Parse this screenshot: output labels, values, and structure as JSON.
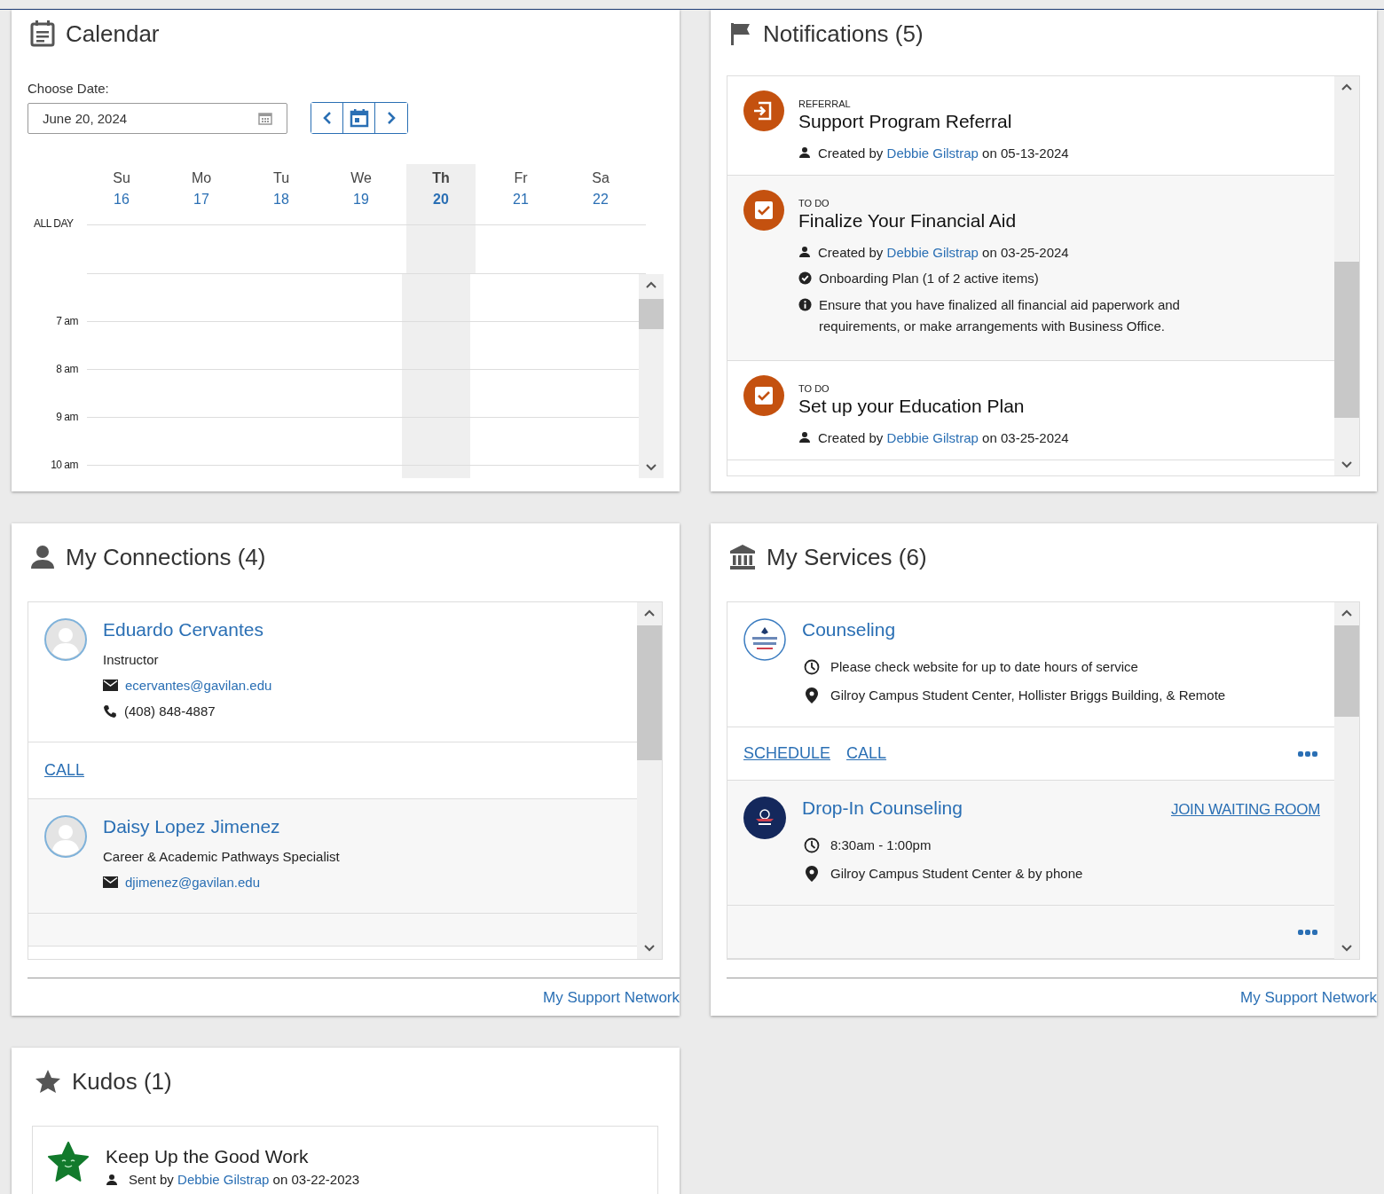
{
  "calendar": {
    "title": "Calendar",
    "date_label": "Choose Date:",
    "date_value": "June 20, 2024",
    "days": [
      {
        "name": "Su",
        "date": "16",
        "selected": false
      },
      {
        "name": "Mo",
        "date": "17",
        "selected": false
      },
      {
        "name": "Tu",
        "date": "18",
        "selected": false
      },
      {
        "name": "We",
        "date": "19",
        "selected": false
      },
      {
        "name": "Th",
        "date": "20",
        "selected": true
      },
      {
        "name": "Fr",
        "date": "21",
        "selected": false
      },
      {
        "name": "Sa",
        "date": "22",
        "selected": false
      }
    ],
    "all_day_label": "ALL DAY",
    "hours": [
      "7 am",
      "8 am",
      "9 am",
      "10 am"
    ]
  },
  "notifications": {
    "title": "Notifications (5)",
    "items": [
      {
        "kind": "referral",
        "category": "REFERRAL",
        "title": "Support Program Referral",
        "details": [
          {
            "kind": "creator",
            "prefix": "Created by",
            "person": "Debbie Gilstrap",
            "suffix": "on 05-13-2024"
          }
        ]
      },
      {
        "kind": "todo",
        "category": "TO DO",
        "title": "Finalize Your Financial Aid",
        "details": [
          {
            "kind": "creator",
            "prefix": "Created by",
            "person": "Debbie Gilstrap",
            "suffix": "on 03-25-2024"
          },
          {
            "kind": "plan",
            "text": "Onboarding Plan (1 of 2 active items)"
          },
          {
            "kind": "info",
            "text": "Ensure that you have finalized all financial aid paperwork and requirements, or make arrangements with Business Office."
          }
        ]
      },
      {
        "kind": "todo",
        "category": "TO DO",
        "title": "Set up your Education Plan",
        "details": [
          {
            "kind": "creator",
            "prefix": "Created by",
            "person": "Debbie Gilstrap",
            "suffix": "on 03-25-2024"
          }
        ]
      }
    ]
  },
  "connections": {
    "title": "My Connections (4)",
    "items": [
      {
        "name": "Eduardo Cervantes",
        "role": "Instructor",
        "email": "ecervantes@gavilan.edu",
        "phone": "(408) 848-4887",
        "actions": [
          "CALL"
        ]
      },
      {
        "name": "Daisy Lopez Jimenez",
        "role": "Career & Academic Pathways Specialist",
        "email": "djimenez@gavilan.edu"
      }
    ],
    "footer_link": "My Support Network"
  },
  "services": {
    "title": "My Services (6)",
    "items": [
      {
        "kind": "crest",
        "name": "Counseling",
        "hours": "Please check website for up to date hours of service",
        "location": "Gilroy Campus Student Center, Hollister Briggs Building, & Remote",
        "actions": [
          "SCHEDULE",
          "CALL"
        ]
      },
      {
        "kind": "badge",
        "name": "Drop-In Counseling",
        "join": "JOIN WAITING ROOM",
        "hours": "8:30am - 1:00pm",
        "location": "Gilroy Campus Student Center & by phone"
      }
    ],
    "footer_link": "My Support Network"
  },
  "kudos": {
    "title": "Kudos (1)",
    "items": [
      {
        "title": "Keep Up the Good Work",
        "prefix": "Sent by",
        "person": "Debbie Gilstrap",
        "suffix": "on 03-22-2023"
      }
    ]
  }
}
